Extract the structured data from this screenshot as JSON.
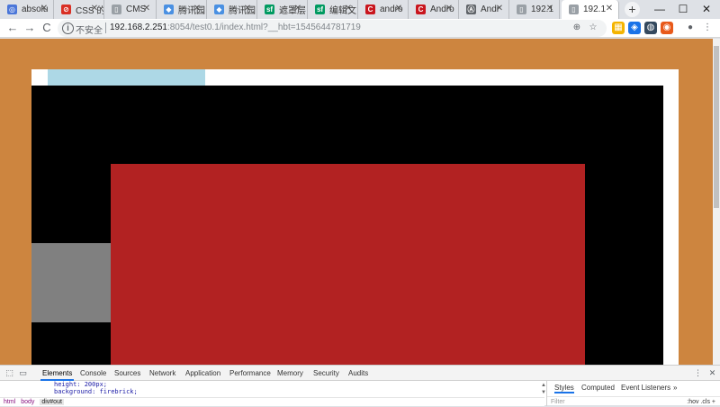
{
  "browser": {
    "tabs": [
      {
        "title": "absolu",
        "icon": "globe-icon",
        "icon_color": "#4a76d9",
        "glyph": "◎"
      },
      {
        "title": "CSS 的",
        "icon": "block-icon",
        "icon_color": "#d93025",
        "glyph": "⊘"
      },
      {
        "title": "CMS",
        "icon": "page-icon",
        "icon_color": "#9aa0a6",
        "glyph": "▯"
      },
      {
        "title": "腾讯园",
        "icon": "tencent-icon",
        "icon_color": "#4a90e2",
        "glyph": "◆"
      },
      {
        "title": "腾讯园",
        "icon": "tencent-icon",
        "icon_color": "#4a90e2",
        "glyph": "◆"
      },
      {
        "title": "遮罩层",
        "icon": "sf-icon",
        "icon_color": "#009a61",
        "glyph": "sf"
      },
      {
        "title": "编辑文",
        "icon": "sf-icon",
        "icon_color": "#009a61",
        "glyph": "sf"
      },
      {
        "title": "andro",
        "icon": "csdn-icon",
        "icon_color": "#c9161e",
        "glyph": "C"
      },
      {
        "title": "Andro",
        "icon": "csdn-icon",
        "icon_color": "#c9161e",
        "glyph": "C"
      },
      {
        "title": "Andr",
        "icon": "android-icon",
        "icon_color": "#5f6368",
        "glyph": "Ⓐ"
      },
      {
        "title": "192.1",
        "icon": "page-icon",
        "icon_color": "#9aa0a6",
        "glyph": "▯"
      },
      {
        "title": "192.1",
        "icon": "page-icon",
        "icon_color": "#9aa0a6",
        "glyph": "▯"
      }
    ],
    "new_tab": "+",
    "window": {
      "minimize": "—",
      "maximize": "☐",
      "close": "✕"
    },
    "toolbar": {
      "back": "←",
      "forward": "→",
      "reload": "C",
      "security_label": "不安全",
      "url_host": "192.168.2.251",
      "url_rest": ":8054/test0.1/index.html?__hbt=1545644781719",
      "zoom": "⊕",
      "star": "☆",
      "ext_icons": [
        "▦",
        "◈",
        "◍",
        "◉"
      ],
      "profile": "●",
      "menu": "⋮"
    }
  },
  "page": {
    "colors": {
      "background": "#cd853f",
      "outer": "#ffffff",
      "header_bar": "#add8e6",
      "out": "#000000",
      "red": "#b22222",
      "gray": "#808080"
    }
  },
  "devtools": {
    "inspect": "⬚",
    "device": "▭",
    "tabs": [
      "Elements",
      "Console",
      "Sources",
      "Network",
      "Application",
      "Performance",
      "Memory",
      "Security",
      "Audits"
    ],
    "code_lines": [
      "height: 200px;",
      "background: firebrick;"
    ],
    "breadcrumb": [
      "html",
      "body",
      "div#out"
    ],
    "styles_tabs": [
      "Styles",
      "Computed",
      "Event Listeners"
    ],
    "more": "»",
    "filter": "Filter",
    "hov": ":hov  .cls  +",
    "menu": "⋮",
    "close": "✕"
  }
}
